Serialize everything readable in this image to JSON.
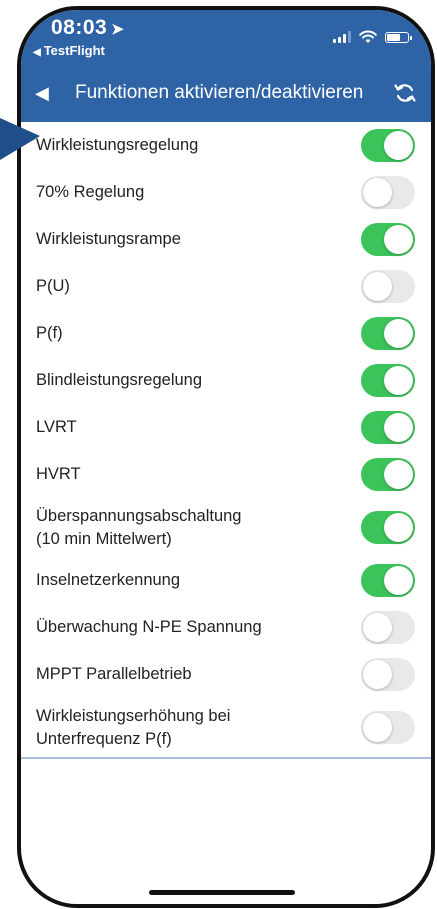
{
  "status_bar": {
    "time": "08:03",
    "back_app": "TestFlight"
  },
  "navbar": {
    "title": "Funktionen aktivieren/deaktivieren"
  },
  "functions": [
    {
      "label": "Wirkleistungsregelung",
      "enabled": true
    },
    {
      "label": "70% Regelung",
      "enabled": false
    },
    {
      "label": "Wirkleistungsrampe",
      "enabled": true
    },
    {
      "label": "P(U)",
      "enabled": false
    },
    {
      "label": "P(f)",
      "enabled": true
    },
    {
      "label": "Blindleistungsregelung",
      "enabled": true
    },
    {
      "label": "LVRT",
      "enabled": true
    },
    {
      "label": "HVRT",
      "enabled": true
    },
    {
      "label": "Überspannungsabschaltung\n(10 min Mittelwert)",
      "enabled": true
    },
    {
      "label": "Inselnetzerkennung",
      "enabled": true
    },
    {
      "label": "Überwachung N-PE Spannung",
      "enabled": false
    },
    {
      "label": "MPPT Parallelbetrieb",
      "enabled": false
    },
    {
      "label": "Wirkleistungserhöhung bei\nUnterfrequenz P(f)",
      "enabled": false
    }
  ],
  "colors": {
    "header": "#2e63a5",
    "toggle_on": "#3cc35a",
    "toggle_off": "#e9e9ea",
    "pointer_arrow": "#1f4f8a"
  },
  "icons": {
    "location": "location-arrow-icon",
    "signal": "cellular-signal-icon",
    "wifi": "wifi-icon",
    "battery": "battery-icon",
    "back": "back-triangle-icon",
    "refresh": "refresh-icon"
  }
}
